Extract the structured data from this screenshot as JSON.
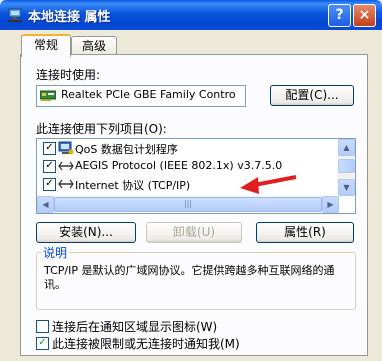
{
  "window": {
    "title": "本地连接 属性",
    "help_label": "?",
    "close_label": "×"
  },
  "tabs": [
    {
      "label": "常规",
      "active": true
    },
    {
      "label": "高级",
      "active": false
    }
  ],
  "connect_using": {
    "label_prefix": "连接时使用:",
    "adapter_name": "Realtek PCIe GBE Family Contro",
    "configure_button": "配置(C)..."
  },
  "items_section": {
    "label": "此连接使用下列项目(O):",
    "items": [
      {
        "label": "QoS 数据包计划程序",
        "checked": true,
        "icon": "qos-icon"
      },
      {
        "label": "AEGIS Protocol (IEEE 802.1x) v3.7.5.0",
        "checked": true,
        "icon": "protocol-icon"
      },
      {
        "label": "Internet 协议 (TCP/IP)",
        "checked": true,
        "icon": "protocol-icon"
      }
    ],
    "hscroll_grip": "|||"
  },
  "buttons": {
    "install": "安装(N)...",
    "uninstall": "卸载(U)",
    "properties": "属性(R)"
  },
  "description": {
    "legend": "说明",
    "text": "TCP/IP 是默认的广域网协议。它提供跨越多种互联网络的通讯。"
  },
  "options": [
    {
      "label": "连接后在通知区域显示图标(W)",
      "checked": false
    },
    {
      "label": "此连接被限制或无连接时通知我(M)",
      "checked": true
    }
  ],
  "colors": {
    "accent": "#0046d5",
    "annotation_arrow": "#e02020"
  }
}
